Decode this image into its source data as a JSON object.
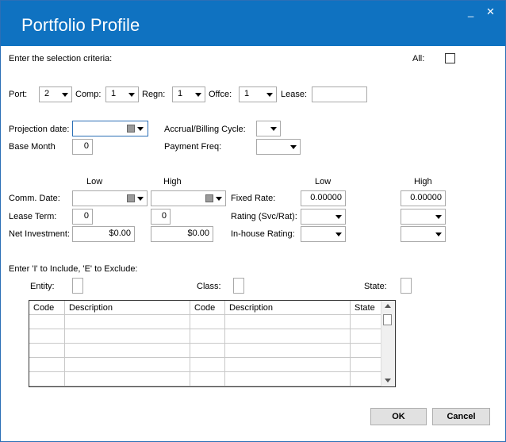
{
  "window": {
    "title": "Portfolio Profile",
    "minimize": "_",
    "close": "✕"
  },
  "criteria": {
    "label": "Enter the selection criteria:",
    "all_label": "All:"
  },
  "top_row": {
    "port_label": "Port:",
    "port_value": "2",
    "comp_label": "Comp:",
    "comp_value": "1",
    "regn_label": "Regn:",
    "regn_value": "1",
    "offce_label": "Offce:",
    "offce_value": "1",
    "lease_label": "Lease:",
    "lease_value": ""
  },
  "dates": {
    "projection_label": "Projection date:",
    "projection_value": "",
    "accrual_label": "Accrual/Billing Cycle:",
    "base_month_label": "Base Month",
    "base_month_value": "0",
    "payment_freq_label": "Payment Freq:"
  },
  "ranges": {
    "low_label": "Low",
    "high_label": "High",
    "low2_label": "Low",
    "high2_label": "High",
    "comm_date_label": "Comm. Date:",
    "lease_term_label": "Lease Term:",
    "lease_term_low": "0",
    "lease_term_high": "0",
    "net_investment_label": "Net Investment:",
    "net_investment_low": "$0.00",
    "net_investment_high": "$0.00",
    "fixed_rate_label": "Fixed Rate:",
    "fixed_rate_low": "0.00000",
    "fixed_rate_high": "0.00000",
    "rating_label": "Rating (Svc/Rat):",
    "inhouse_label": "In-house Rating:"
  },
  "include": {
    "label": "Enter 'I' to Include, 'E' to Exclude:",
    "entity_label": "Entity:",
    "class_label": "Class:",
    "state_label": "State:"
  },
  "table": {
    "columns": [
      "Code",
      "Description",
      "Code",
      "Description",
      "State"
    ],
    "rows": [
      [
        "",
        "",
        "",
        "",
        ""
      ],
      [
        "",
        "",
        "",
        "",
        ""
      ],
      [
        "",
        "",
        "",
        "",
        ""
      ],
      [
        "",
        "",
        "",
        "",
        ""
      ],
      [
        "",
        "",
        "",
        "",
        ""
      ]
    ]
  },
  "buttons": {
    "ok": "OK",
    "cancel": "Cancel"
  }
}
